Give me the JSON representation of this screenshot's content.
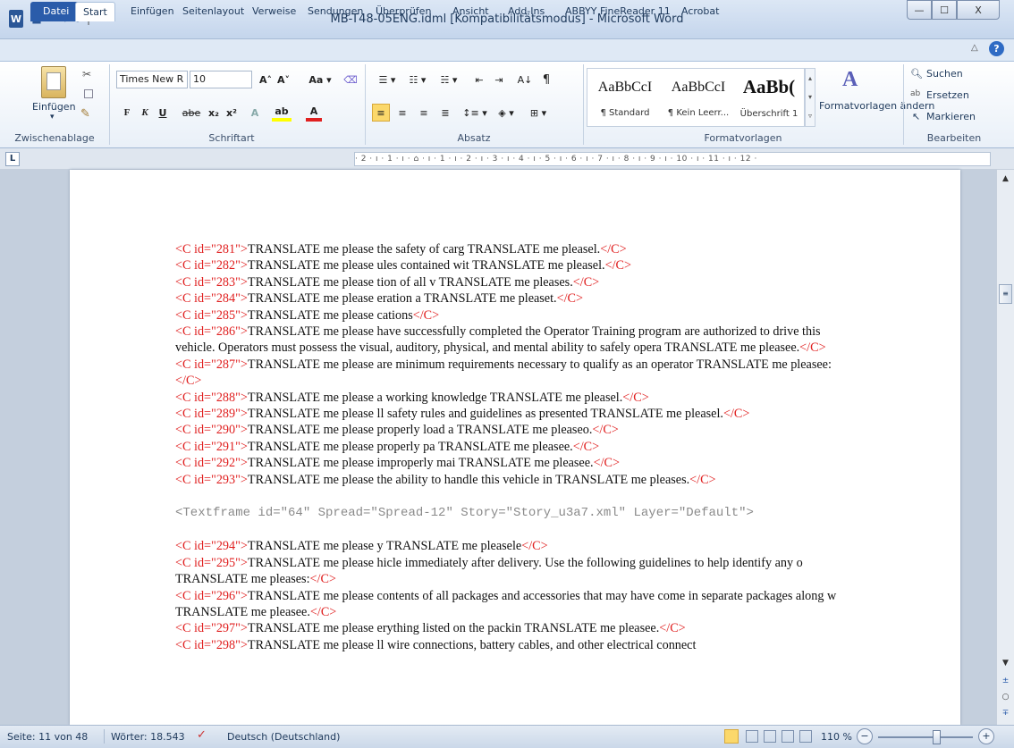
{
  "window": {
    "title": "MB-T48-05ENG.idml [Kompatibilitätsmodus] - Microsoft Word",
    "minimize": "—",
    "maximize": "☐",
    "close": "X",
    "qat": {
      "word_logo": "W",
      "save": "■",
      "undo": "↶ ▾",
      "redo": "↺",
      "customize": "|="
    }
  },
  "tabs": [
    "Datei",
    "Start",
    "Einfügen",
    "Seitenlayout",
    "Verweise",
    "Sendungen",
    "Überprüfen",
    "Ansicht",
    "Add-Ins",
    "ABBYY FineReader 11",
    "Acrobat"
  ],
  "tab_icons": {
    "collapse": "△",
    "help": "?"
  },
  "ribbon": {
    "clipboard": {
      "paste": "Einfügen",
      "paste_arrow": "▾",
      "label": "Zwischenablage"
    },
    "font": {
      "family": "Times New R",
      "size": "10",
      "grow": "A˄",
      "shrink": "A˅",
      "case": "Aa ▾",
      "bold": "F",
      "italic": "K",
      "underline": "U",
      "strike": "abe",
      "subscript": "x₂",
      "superscript": "x²",
      "highlight": "ab",
      "color": "A",
      "label": "Schriftart"
    },
    "paragraph": {
      "label": "Absatz",
      "pilcrow": "¶",
      "sort": "A↓"
    },
    "styles": {
      "items": [
        {
          "preview": "AaBbCcI",
          "name": "¶ Standard"
        },
        {
          "preview": "AaBbCcI",
          "name": "¶ Kein Leerr..."
        },
        {
          "preview": "AaBb(",
          "name": "Überschrift 1"
        }
      ],
      "change": "Formatvorlagen ändern",
      "change_arrow": "▾",
      "label": "Formatvorlagen"
    },
    "editing": {
      "search": "Suchen",
      "replace": "Ersetzen",
      "select": "Markieren",
      "label": "Bearbeiten"
    }
  },
  "ruler": "· 2 · ı · 1 · ı · ⌂ · ı · 1 · ı · 2 · ı · 3 · ı · 4 · ı · 5 · ı · 6 · ı · 7 · ı · 8 · ı · 9 · ı · 10 · ı · 11 · ı · 12 ·",
  "ruler_button": "L",
  "document": {
    "paragraphs": [
      [
        {
          "t": "<C id=\"281\">",
          "c": "tag"
        },
        {
          "t": "TRANSLATE  me please  the safety of carg TRANSLATE  me pleasel."
        },
        {
          "t": "</C>",
          "c": "tag"
        }
      ],
      [
        {
          "t": "<C id=\"282\">",
          "c": "tag"
        },
        {
          "t": "TRANSLATE  me please  ules contained wit TRANSLATE  me pleasel."
        },
        {
          "t": "</C>",
          "c": "tag"
        }
      ],
      [
        {
          "t": "<C id=\"283\">",
          "c": "tag"
        },
        {
          "t": "TRANSLATE  me please  tion of all v TRANSLATE  me pleases."
        },
        {
          "t": "</C>",
          "c": "tag"
        }
      ],
      [
        {
          "t": "<C id=\"284\">",
          "c": "tag"
        },
        {
          "t": "TRANSLATE  me please  eration a TRANSLATE  me pleaset."
        },
        {
          "t": "</C>",
          "c": "tag"
        }
      ],
      [
        {
          "t": "<C id=\"285\">",
          "c": "tag"
        },
        {
          "t": "TRANSLATE  me please  cations"
        },
        {
          "t": "</C>",
          "c": "tag"
        }
      ],
      [
        {
          "t": "<C id=\"286\">",
          "c": "tag"
        },
        {
          "t": "TRANSLATE  me please   have successfully completed the Operator Training program are authorized to drive this vehicle. Operators must possess the visual, auditory, physical, and mental ability to safely opera TRANSLATE  me pleasee."
        },
        {
          "t": "</C>",
          "c": "tag"
        }
      ],
      [
        {
          "t": "<C id=\"287\">",
          "c": "tag"
        },
        {
          "t": "TRANSLATE  me please  are minimum requirements necessary to qualify as an operator TRANSLATE  me pleasee:"
        },
        {
          "t": "</C>",
          "c": "tag"
        }
      ],
      [
        {
          "t": "<C id=\"288\">",
          "c": "tag"
        },
        {
          "t": "TRANSLATE  me please  a working knowledge   TRANSLATE  me pleasel."
        },
        {
          "t": "</C>",
          "c": "tag"
        }
      ],
      [
        {
          "t": "<C id=\"289\">",
          "c": "tag"
        },
        {
          "t": "TRANSLATE  me please  ll safety rules and guidelines as presented TRANSLATE  me pleasel."
        },
        {
          "t": "</C>",
          "c": "tag"
        }
      ],
      [
        {
          "t": "<C id=\"290\">",
          "c": "tag"
        },
        {
          "t": "TRANSLATE  me please  properly load a TRANSLATE  me pleaseo."
        },
        {
          "t": "</C>",
          "c": "tag"
        }
      ],
      [
        {
          "t": "<C id=\"291\">",
          "c": "tag"
        },
        {
          "t": "TRANSLATE  me please  properly pa TRANSLATE  me pleasee."
        },
        {
          "t": "</C>",
          "c": "tag"
        }
      ],
      [
        {
          "t": "<C id=\"292\">",
          "c": "tag"
        },
        {
          "t": "TRANSLATE  me please   improperly mai TRANSLATE  me pleasee."
        },
        {
          "t": "</C>",
          "c": "tag"
        }
      ],
      [
        {
          "t": "<C id=\"293\">",
          "c": "tag"
        },
        {
          "t": "TRANSLATE  me please  the ability to handle this vehicle in TRANSLATE  me pleases."
        },
        {
          "t": "</C>",
          "c": "tag"
        }
      ],
      [],
      [
        {
          "t": "<Textframe id=\"64\" Spread=\"Spread-12\" Story=\"Story_u3a7.xml\" Layer=\"Default\">",
          "c": "mono"
        }
      ],
      [],
      [
        {
          "t": "<C id=\"294\">",
          "c": "tag"
        },
        {
          "t": "TRANSLATE  me please  y TRANSLATE  me pleasele"
        },
        {
          "t": "</C>",
          "c": "tag"
        }
      ],
      [
        {
          "t": "<C id=\"295\">",
          "c": "tag"
        },
        {
          "t": "TRANSLATE  me please  hicle immediately after delivery. Use  the following guidelines to help identify any o TRANSLATE  me pleases:"
        },
        {
          "t": "</C>",
          "c": "tag"
        }
      ],
      [
        {
          "t": "<C id=\"296\">",
          "c": "tag"
        },
        {
          "t": "TRANSLATE  me please  contents of all packages and accessories that may have come in separate packages along w TRANSLATE  me pleasee."
        },
        {
          "t": "</C>",
          "c": "tag"
        }
      ],
      [
        {
          "t": "<C id=\"297\">",
          "c": "tag"
        },
        {
          "t": "TRANSLATE  me please  erything listed on the packin TRANSLATE  me pleasee."
        },
        {
          "t": "</C>",
          "c": "tag"
        }
      ],
      [
        {
          "t": "<C id=\"298\">",
          "c": "tag"
        },
        {
          "t": "TRANSLATE  me please  ll wire connections, battery cables, and other electrical connect"
        }
      ]
    ]
  },
  "scrollbar": {
    "up": "▲",
    "down": "▼",
    "prev_page": "±",
    "browse": "○",
    "next_page": "∓",
    "thumb": "≡"
  },
  "status": {
    "page": "Seite: 11 von 48",
    "words": "Wörter: 18.543",
    "language": "Deutsch (Deutschland)",
    "zoom": "110 %",
    "zoom_minus": "−",
    "zoom_plus": "+",
    "zoom_fraction": 0.62
  },
  "colors": {
    "tag": "#e02020",
    "file_tab": "#2a5caa",
    "mono_gray": "#8a8a8a"
  }
}
